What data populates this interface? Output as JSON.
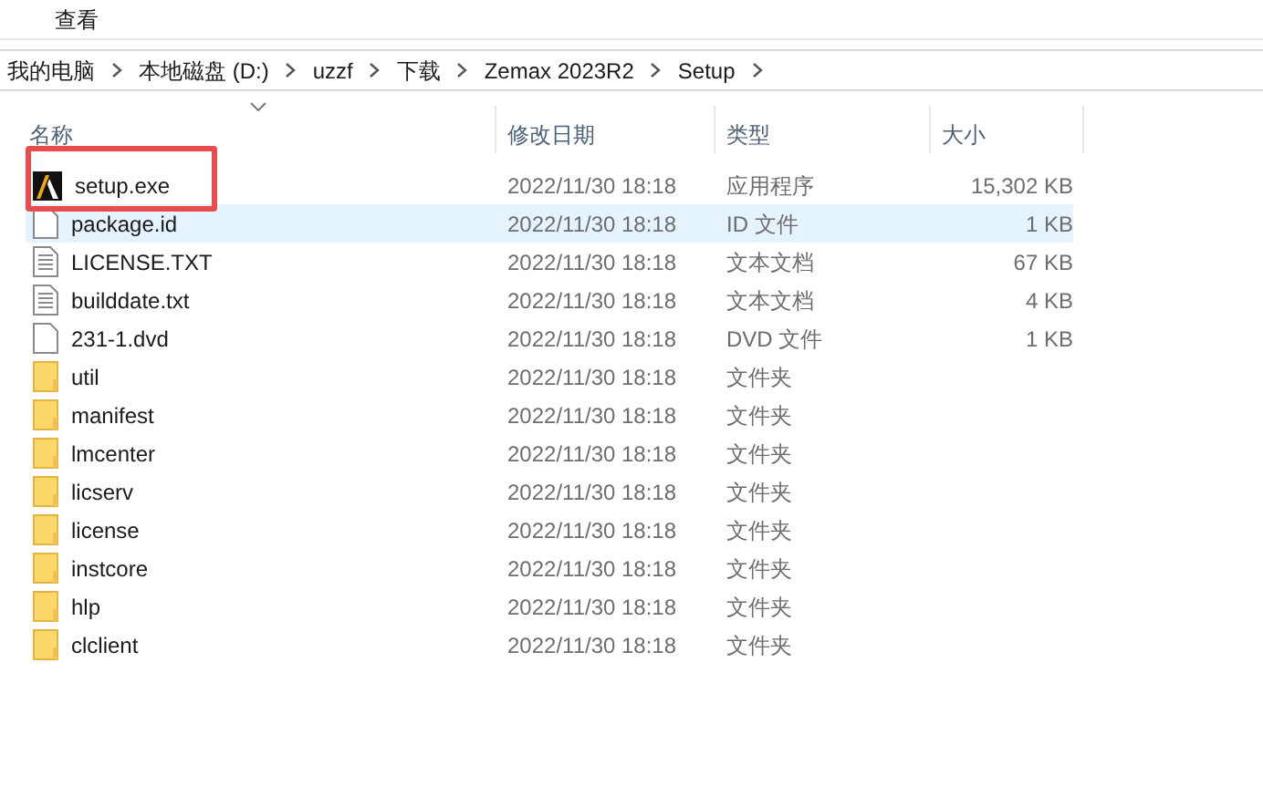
{
  "menu": [
    {
      "label": "查看"
    }
  ],
  "breadcrumb": [
    "我的电脑",
    "本地磁盘 (D:)",
    "uzzf",
    "下载",
    "Zemax 2023R2",
    "Setup"
  ],
  "columns": [
    "名称",
    "修改日期",
    "类型",
    "大小"
  ],
  "rows": [
    {
      "name": "setup.exe",
      "date": "2022/11/30 18:18",
      "type": "应用程序",
      "size": "15,302 KB",
      "kind": "app",
      "hovered": false,
      "annotated": true
    },
    {
      "name": "package.id",
      "date": "2022/11/30 18:18",
      "type": "ID 文件",
      "size": "1 KB",
      "kind": "file",
      "hovered": true,
      "annotated": false
    },
    {
      "name": "LICENSE.TXT",
      "date": "2022/11/30 18:18",
      "type": "文本文档",
      "size": "67 KB",
      "kind": "text",
      "hovered": false,
      "annotated": false
    },
    {
      "name": "builddate.txt",
      "date": "2022/11/30 18:18",
      "type": "文本文档",
      "size": "4 KB",
      "kind": "text",
      "hovered": false,
      "annotated": false
    },
    {
      "name": "231-1.dvd",
      "date": "2022/11/30 18:18",
      "type": "DVD 文件",
      "size": "1 KB",
      "kind": "file",
      "hovered": false,
      "annotated": false
    },
    {
      "name": "util",
      "date": "2022/11/30 18:18",
      "type": "文件夹",
      "kind": "folder",
      "hovered": false,
      "annotated": false
    },
    {
      "name": "manifest",
      "date": "2022/11/30 18:18",
      "type": "文件夹",
      "kind": "folder",
      "hovered": false,
      "annotated": false
    },
    {
      "name": "lmcenter",
      "date": "2022/11/30 18:18",
      "type": "文件夹",
      "kind": "folder",
      "hovered": false,
      "annotated": false
    },
    {
      "name": "licserv",
      "date": "2022/11/30 18:18",
      "type": "文件夹",
      "kind": "folder",
      "hovered": false,
      "annotated": false
    },
    {
      "name": "license",
      "date": "2022/11/30 18:18",
      "type": "文件夹",
      "kind": "folder",
      "hovered": false,
      "annotated": false
    },
    {
      "name": "instcore",
      "date": "2022/11/30 18:18",
      "type": "文件夹",
      "kind": "folder",
      "hovered": false,
      "annotated": false
    },
    {
      "name": "hlp",
      "date": "2022/11/30 18:18",
      "type": "文件夹",
      "kind": "folder",
      "hovered": false,
      "annotated": false
    },
    {
      "name": "clclient",
      "date": "2022/11/30 18:18",
      "type": "文件夹",
      "kind": "folder",
      "hovered": false,
      "annotated": false
    }
  ]
}
